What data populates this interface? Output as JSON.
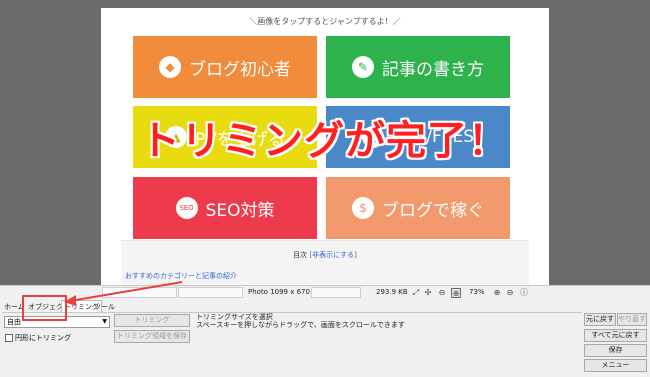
{
  "page": {
    "hint": "＼画像をタップするとジャンプするよ！／",
    "tiles": [
      {
        "label": "ブログ初心者",
        "icon": "beginner-mark-icon"
      },
      {
        "label": "記事の書き方",
        "icon": "note-pencil-icon"
      },
      {
        "label": "PVを上げる",
        "icon": "chart-icon"
      },
      {
        "label": "SNS/FEES",
        "icon": "sns-icon"
      },
      {
        "label": "SEO対策",
        "icon": "seo-badge-icon"
      },
      {
        "label": "ブログで稼ぐ",
        "icon": "money-bag-icon"
      }
    ],
    "toc_title": "目次",
    "toc_toggle": "[非表示にする]",
    "toc_item": "おすすめのカテゴリーと記事の紹介",
    "overlay": "トリミングが完了！",
    "overlay_color": "#ff1f1f"
  },
  "status": {
    "dimensions": "Photo 1099 x 670",
    "file_size": "293.9 KB",
    "zoom": "73%"
  },
  "tabs": [
    "ホーム",
    "オブジェクト",
    "トリミング",
    "ツール"
  ],
  "trim": {
    "mode": "自由",
    "circle_label": "円形にトリミング",
    "trim_button": "トリミング",
    "save_region_button": "トリミング領域を保存",
    "info_line1": "トリミングサイズを選択",
    "info_line2": "スペースキーを押しながらドラッグで、画面をスクロールできます"
  },
  "actions": {
    "undo": "元に戻す",
    "redo": "やり直す",
    "revert": "すべて元に戻す",
    "save": "保存",
    "menu": "メニュー"
  },
  "highlight_color": "#e8403f"
}
